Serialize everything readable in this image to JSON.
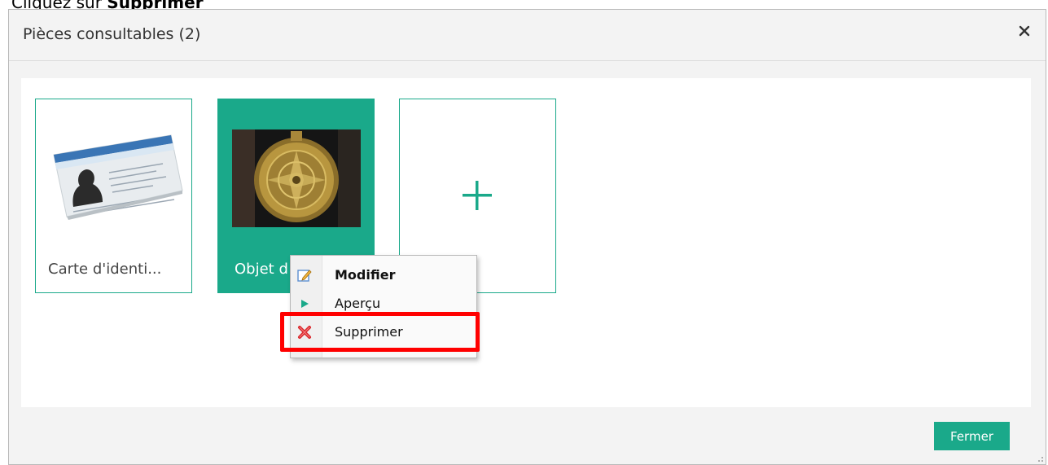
{
  "instruction": {
    "prefix": "Cliquez sur ",
    "bold": "Supprimer"
  },
  "dialog": {
    "title": "Pièces consultables (2)",
    "close_symbol": "×",
    "close_icon": "close-icon"
  },
  "cards": [
    {
      "label": "Carte d'identi...",
      "icon": "id-card-image",
      "selected": false
    },
    {
      "label": "Objet d",
      "icon": "astrolabe-photo",
      "selected": true
    },
    {
      "label": "",
      "icon": "plus-icon",
      "selected": false
    }
  ],
  "context_menu": {
    "items": [
      {
        "label": "Modifier",
        "icon": "edit-pencil-icon",
        "bold": true
      },
      {
        "label": "Aperçu",
        "icon": "play-icon",
        "bold": false
      },
      {
        "label": "Supprimer",
        "icon": "delete-x-icon",
        "bold": false,
        "highlighted": true
      }
    ]
  },
  "footer": {
    "close_label": "Fermer"
  },
  "colors": {
    "accent": "#1aa98a",
    "highlight": "#ff0000"
  }
}
